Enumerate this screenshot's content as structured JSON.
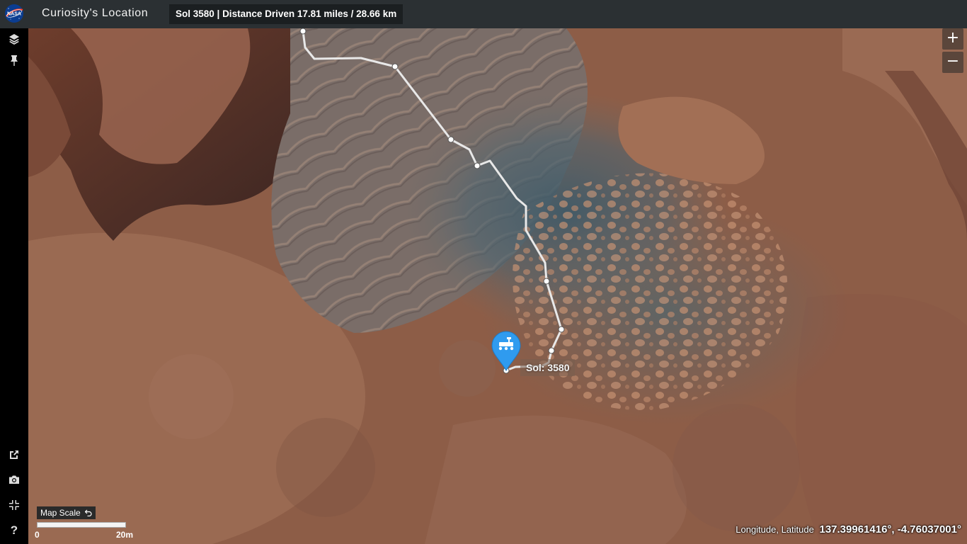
{
  "header": {
    "logo_text": "NASA",
    "title": "Curiosity's Location",
    "stats": "Sol 3580 | Distance Driven 17.81 miles / 28.66 km"
  },
  "sidebar": {
    "top_items": [
      {
        "name": "layers-icon"
      },
      {
        "name": "pin-icon"
      }
    ],
    "bottom_items": [
      {
        "name": "external-link-icon"
      },
      {
        "name": "camera-icon"
      },
      {
        "name": "fullscreen-icon"
      },
      {
        "name": "help-icon"
      }
    ],
    "help_glyph": "?"
  },
  "map": {
    "zoom_in": "+",
    "zoom_out": "−",
    "current_sol_label": "Sol: 3580",
    "scale": {
      "label": "Map Scale",
      "start": "0",
      "end": "20m"
    },
    "coordinates": {
      "label": "Longitude, Latitude",
      "value": "137.39961416°, -4.76037001°"
    },
    "colors": {
      "route": "#e8e8e8",
      "marker": "#2f9bef",
      "terrain_base": "#8a5a45",
      "terrain_blue": "#4a6170"
    }
  }
}
